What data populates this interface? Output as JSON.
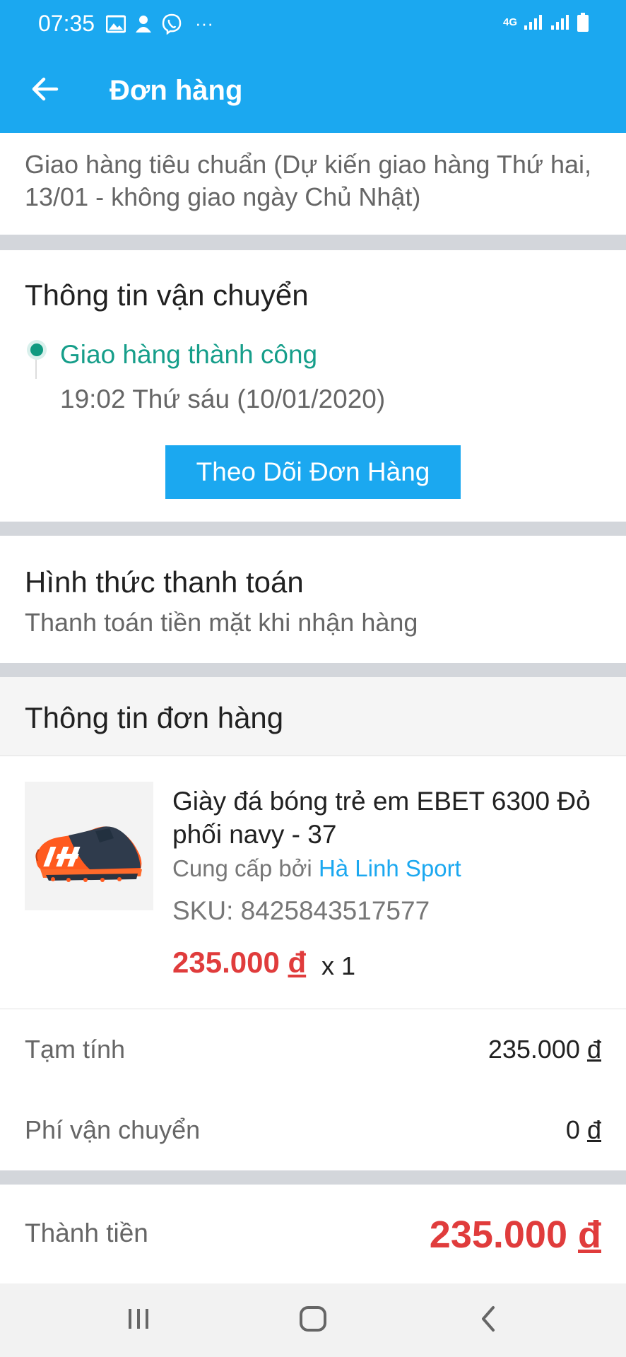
{
  "status_bar": {
    "time": "07:35",
    "network": "4G",
    "dots": "···"
  },
  "app_bar": {
    "title": "Đơn hàng"
  },
  "delivery": {
    "method_text": "Giao hàng tiêu chuẩn (Dự kiến giao hàng Thứ hai, 13/01 - không giao ngày Chủ Nhật)"
  },
  "shipping": {
    "title": "Thông tin vận chuyển",
    "status": "Giao hàng thành công",
    "timestamp": "19:02 Thứ sáu (10/01/2020)",
    "track_button": "Theo Dõi Đơn Hàng"
  },
  "payment": {
    "title": "Hình thức thanh toán",
    "method": "Thanh toán tiền mặt khi nhận hàng"
  },
  "order": {
    "title": "Thông tin đơn hàng",
    "item": {
      "name": "Giày đá bóng trẻ em EBET 6300 Đỏ phối navy - 37",
      "seller_prefix": "Cung cấp bởi",
      "seller_name": "Hà Linh Sport",
      "sku": "SKU: 8425843517577",
      "price_value": "235.000",
      "currency": "đ",
      "quantity": "x 1"
    }
  },
  "summary": {
    "subtotal_label": "Tạm tính",
    "subtotal_value": "235.000",
    "shipping_label": "Phí vận chuyển",
    "shipping_value": "0",
    "total_label": "Thành tiền",
    "total_value": "235.000",
    "currency": "đ"
  },
  "colors": {
    "primary": "#1ba8f0",
    "success": "#169e8a",
    "price": "#e03c3c"
  }
}
